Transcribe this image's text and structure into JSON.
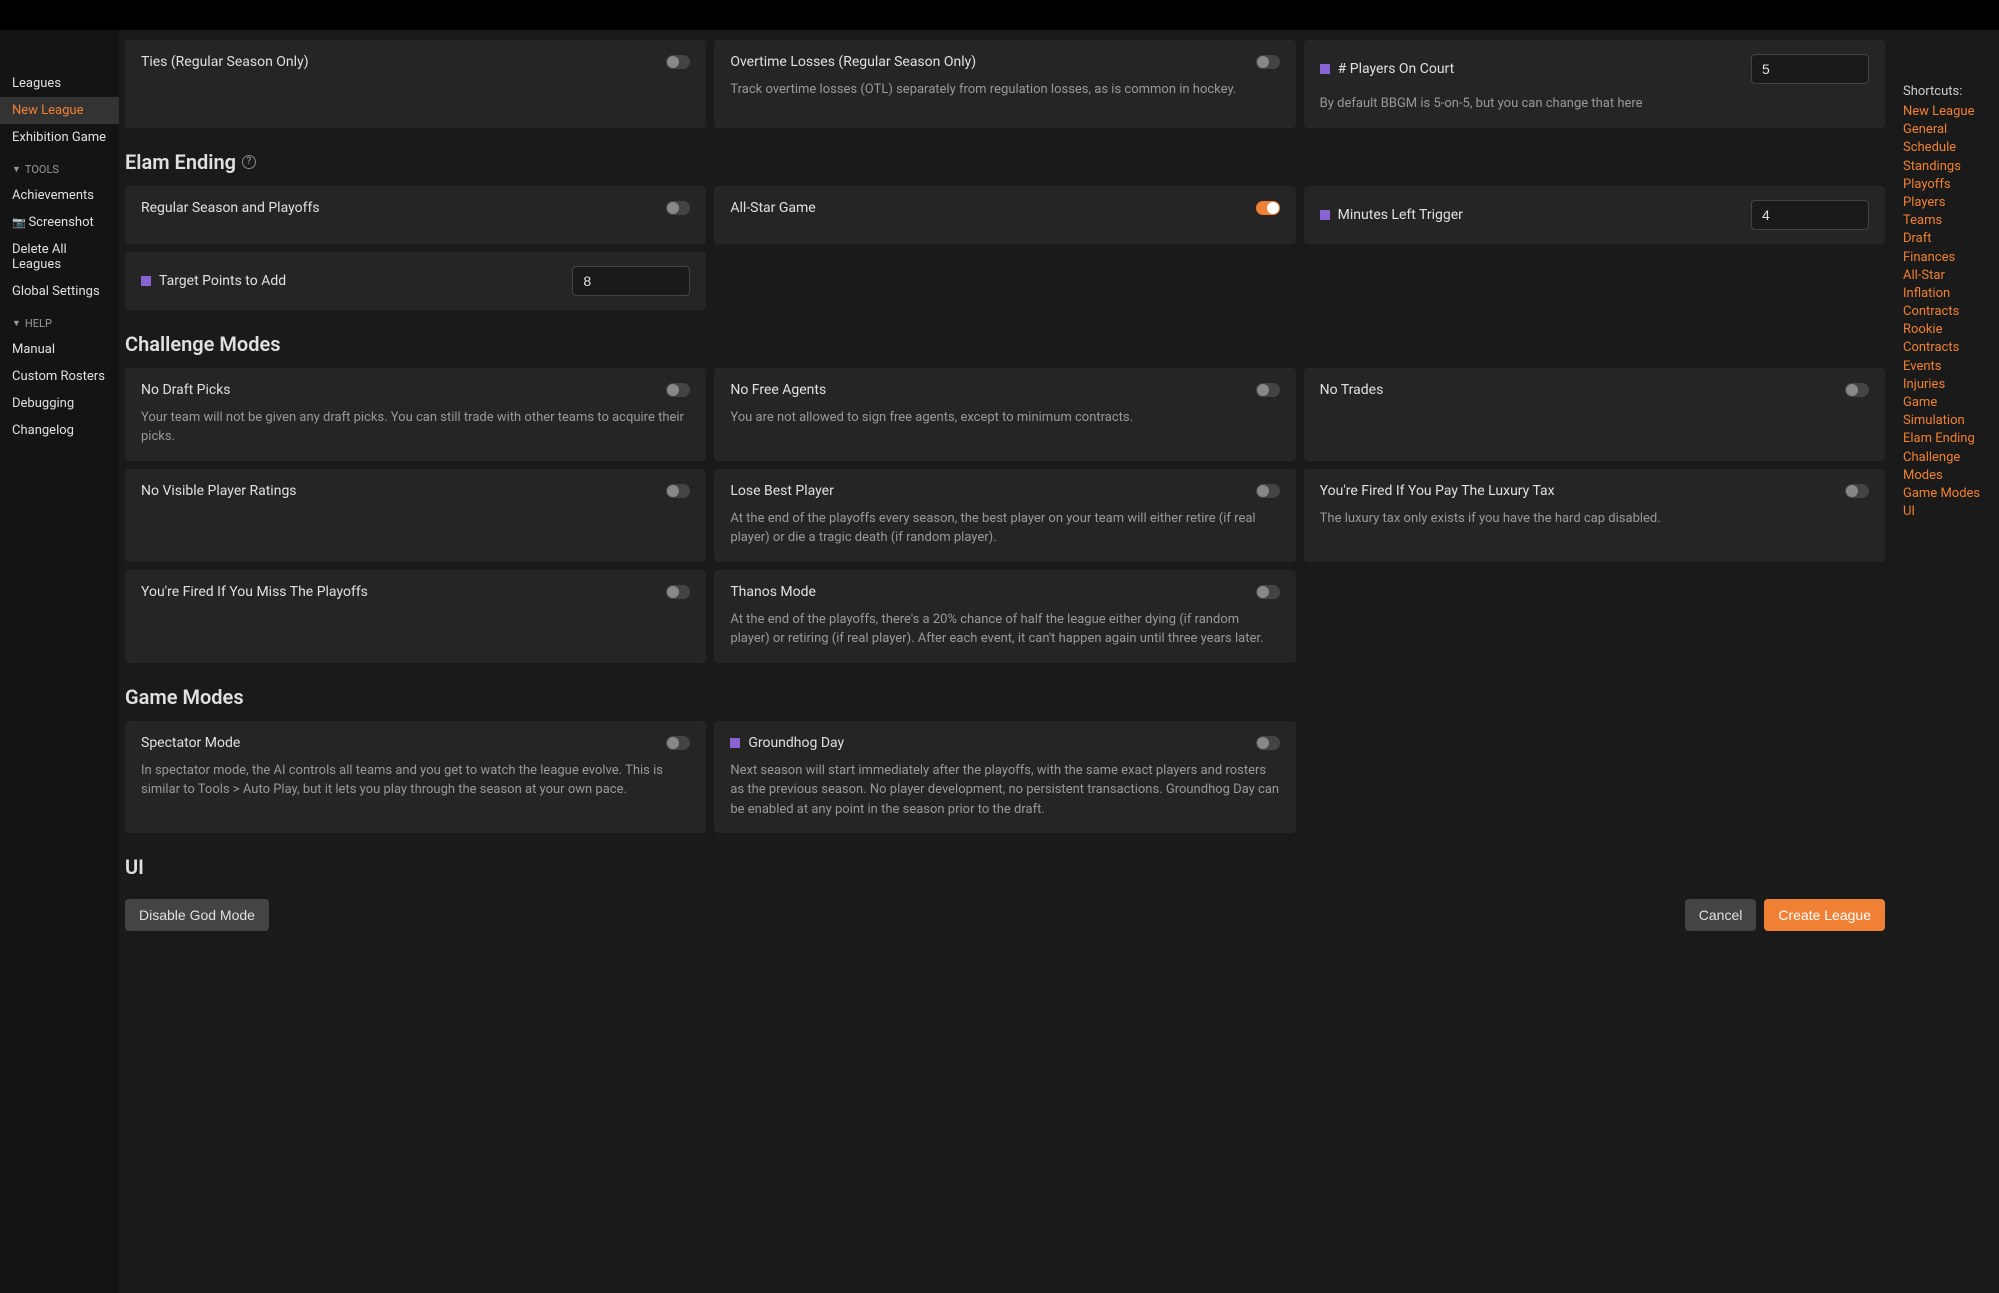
{
  "sidebar": {
    "leagues": "Leagues",
    "new_league": "New League",
    "exhibition": "Exhibition Game",
    "tools_hdr": "TOOLS",
    "achievements": "Achievements",
    "screenshot": "Screenshot",
    "delete_all": "Delete All Leagues",
    "global_settings": "Global Settings",
    "help_hdr": "HELP",
    "manual": "Manual",
    "custom_rosters": "Custom Rosters",
    "debugging": "Debugging",
    "changelog": "Changelog"
  },
  "shortcuts": {
    "hdr": "Shortcuts:",
    "items": [
      "New League",
      "General",
      "Schedule",
      "Standings",
      "Playoffs",
      "Players",
      "Teams",
      "Draft",
      "Finances",
      "All-Star",
      "Inflation",
      "Contracts",
      "Rookie Contracts",
      "Events",
      "Injuries",
      "Game Simulation",
      "Elam Ending",
      "Challenge Modes",
      "Game Modes",
      "UI"
    ]
  },
  "top": {
    "ties": {
      "label": "Ties (Regular Season Only)"
    },
    "otl": {
      "label": "Overtime Losses (Regular Season Only)",
      "desc": "Track overtime losses (OTL) separately from regulation losses, as is common in hockey."
    },
    "players_on_court": {
      "label": "# Players On Court",
      "value": "5",
      "desc": "By default BBGM is 5-on-5, but you can change that here"
    }
  },
  "elam": {
    "title": "Elam Ending",
    "regular": {
      "label": "Regular Season and Playoffs"
    },
    "allstar": {
      "label": "All-Star Game"
    },
    "minutes": {
      "label": "Minutes Left Trigger",
      "value": "4"
    },
    "target": {
      "label": "Target Points to Add",
      "value": "8"
    }
  },
  "challenge": {
    "title": "Challenge Modes",
    "no_draft": {
      "label": "No Draft Picks",
      "desc": "Your team will not be given any draft picks. You can still trade with other teams to acquire their picks."
    },
    "no_fa": {
      "label": "No Free Agents",
      "desc": "You are not allowed to sign free agents, except to minimum contracts."
    },
    "no_trades": {
      "label": "No Trades"
    },
    "no_ratings": {
      "label": "No Visible Player Ratings"
    },
    "lose_best": {
      "label": "Lose Best Player",
      "desc": "At the end of the playoffs every season, the best player on your team will either retire (if real player) or die a tragic death (if random player)."
    },
    "fired_lux": {
      "label": "You're Fired If You Pay The Luxury Tax",
      "desc": "The luxury tax only exists if you have the hard cap disabled."
    },
    "fired_playoffs": {
      "label": "You're Fired If You Miss The Playoffs"
    },
    "thanos": {
      "label": "Thanos Mode",
      "desc": "At the end of the playoffs, there's a 20% chance of half the league either dying (if random player) or retiring (if real player). After each event, it can't happen again until three years later."
    }
  },
  "modes": {
    "title": "Game Modes",
    "spectator": {
      "label": "Spectator Mode",
      "desc": "In spectator mode, the AI controls all teams and you get to watch the league evolve. This is similar to Tools > Auto Play, but it lets you play through the season at your own pace."
    },
    "groundhog": {
      "label": "Groundhog Day",
      "desc": "Next season will start immediately after the playoffs, with the same exact players and rosters as the previous season. No player development, no persistent transactions. Groundhog Day can be enabled at any point in the season prior to the draft."
    }
  },
  "ui_section": {
    "title": "UI"
  },
  "footer": {
    "disable_god": "Disable God Mode",
    "cancel": "Cancel",
    "create": "Create League"
  }
}
